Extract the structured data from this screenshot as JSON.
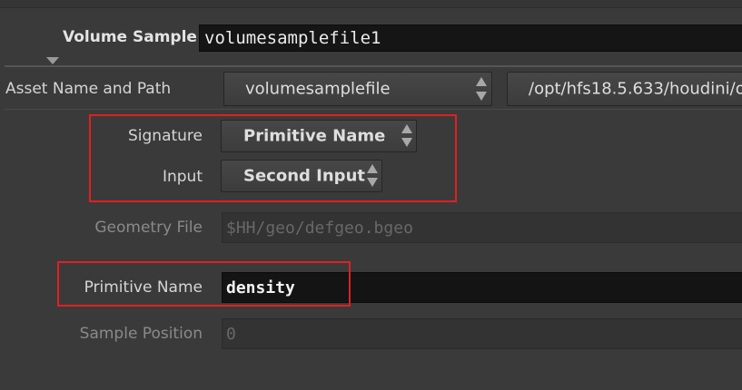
{
  "node": {
    "label": "Volume Sample",
    "name_value": "volumesamplefile1"
  },
  "asset": {
    "label": "Asset Name and Path",
    "name_value": "volumesamplefile",
    "path_value": "/opt/hfs18.5.633/houdini/o"
  },
  "signature": {
    "label": "Signature",
    "value": "Primitive Name"
  },
  "input": {
    "label": "Input",
    "value": "Second Input"
  },
  "geometry_file": {
    "label": "Geometry File",
    "value": "$HH/geo/defgeo.bgeo"
  },
  "primitive_name": {
    "label": "Primitive Name",
    "value": "density"
  },
  "sample_position": {
    "label": "Sample Position",
    "value": "0"
  },
  "colors": {
    "highlight": "#e21f1f",
    "background": "#3a3a3a",
    "field_bg": "#151515"
  }
}
